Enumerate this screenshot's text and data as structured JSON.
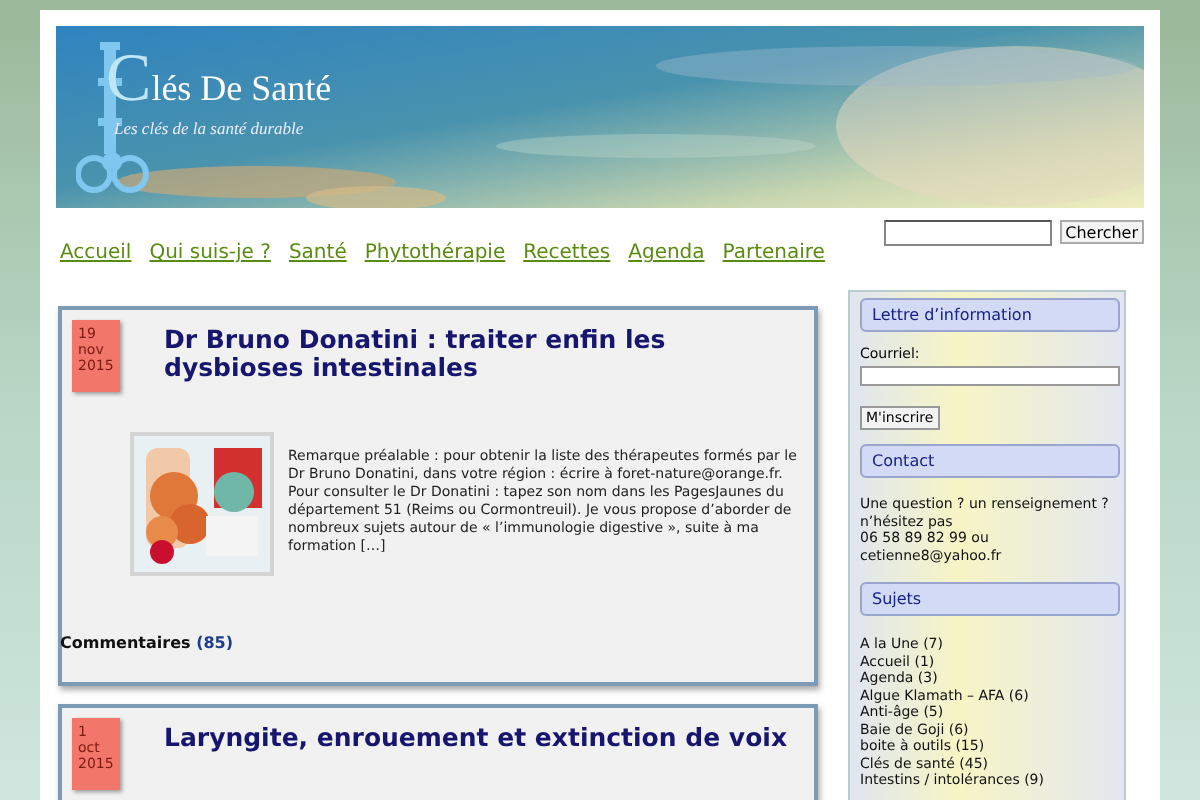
{
  "header": {
    "site_title": "Clés De Santé",
    "tagline": "Les clés de la santé durable"
  },
  "search": {
    "button": "Chercher"
  },
  "nav": [
    {
      "label": "Accueil"
    },
    {
      "label": "Qui suis-je ?"
    },
    {
      "label": "Santé"
    },
    {
      "label": "Phytothérapie"
    },
    {
      "label": "Recettes"
    },
    {
      "label": "Agenda"
    },
    {
      "label": "Partenaire"
    }
  ],
  "posts": [
    {
      "day": "19",
      "month": "nov",
      "year": "2015",
      "title": "Dr Bruno Donatini : traiter enfin les dysbioses intestinales",
      "excerpt": "Remarque préalable : pour obtenir la liste des thérapeutes formés par le Dr Bruno Donatini, dans votre région : écrire à foret-nature@orange.fr. Pour consulter le Dr Donatini : tapez son nom dans les PagesJaunes du département 51 (Reims ou Cormontreuil).   Je vous propose d’aborder de nombreux sujets autour de « l’immunologie digestive », suite à ma formation […]",
      "comments_label": "Commentaires",
      "comments_count": "(85)"
    },
    {
      "day": "1",
      "month": "oct",
      "year": "2015",
      "title": "Laryngite, enrouement et extinction de voix"
    }
  ],
  "sidebar": {
    "newsletter": {
      "heading": "Lettre d’information",
      "email_label": "Courriel:",
      "button": "M'inscrire"
    },
    "contact": {
      "heading": "Contact",
      "lines": [
        "Une question ? un renseignement ?",
        "n’hésitez pas",
        "06 58 89 82 99 ou",
        "cetienne8@yahoo.fr"
      ]
    },
    "topics": {
      "heading": "Sujets",
      "items": [
        "A la Une (7)",
        "Accueil (1)",
        "Agenda (3)",
        "Algue Klamath – AFA (6)",
        "Anti-âge (5)",
        "Baie de Goji (6)",
        "boite à outils (15)",
        "Clés de santé (45)",
        "Intestins / intolérances (9)"
      ]
    }
  }
}
